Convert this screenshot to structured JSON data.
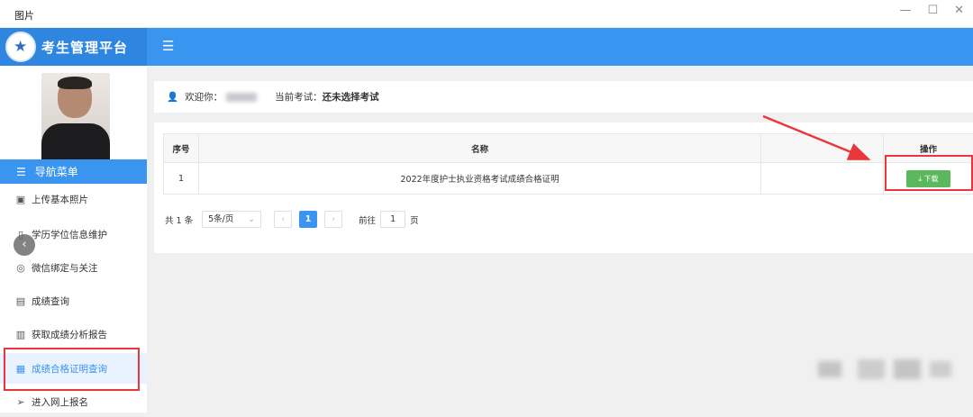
{
  "window": {
    "title": "图片",
    "controls": [
      "—",
      "☐",
      "✕"
    ]
  },
  "brand": {
    "name": "考生管理平台"
  },
  "sidebar": {
    "nav_header": "导航菜单",
    "items": [
      {
        "label": "上传基本照片",
        "icon": "image-icon"
      },
      {
        "label": "学历学位信息维护",
        "icon": "book-icon"
      },
      {
        "label": "微信绑定与关注",
        "icon": "wechat-icon"
      },
      {
        "label": "成绩查询",
        "icon": "search-doc-icon"
      },
      {
        "label": "获取成绩分析报告",
        "icon": "report-icon"
      },
      {
        "label": "成绩合格证明查询",
        "icon": "certificate-icon",
        "active": true
      },
      {
        "label": "进入网上报名",
        "icon": "send-icon"
      }
    ]
  },
  "welcome": {
    "prefix": "欢迎你：",
    "exam_label": "当前考试：",
    "exam_value": "还未选择考试"
  },
  "table": {
    "headers": [
      "序号",
      "名称",
      "",
      "操作"
    ],
    "rows": [
      {
        "index": "1",
        "name": "2022年度护士执业资格考试成绩合格证明",
        "action": "⤓ 下载"
      }
    ]
  },
  "pager": {
    "total": "共 1 条",
    "page_size": "5条/页",
    "current_page": "1",
    "goto_label": "前往",
    "goto_value": "1",
    "page_suffix": "页"
  },
  "colors": {
    "primary": "#3a95f0",
    "download": "#5cb85c",
    "highlight": "#e8383d"
  }
}
